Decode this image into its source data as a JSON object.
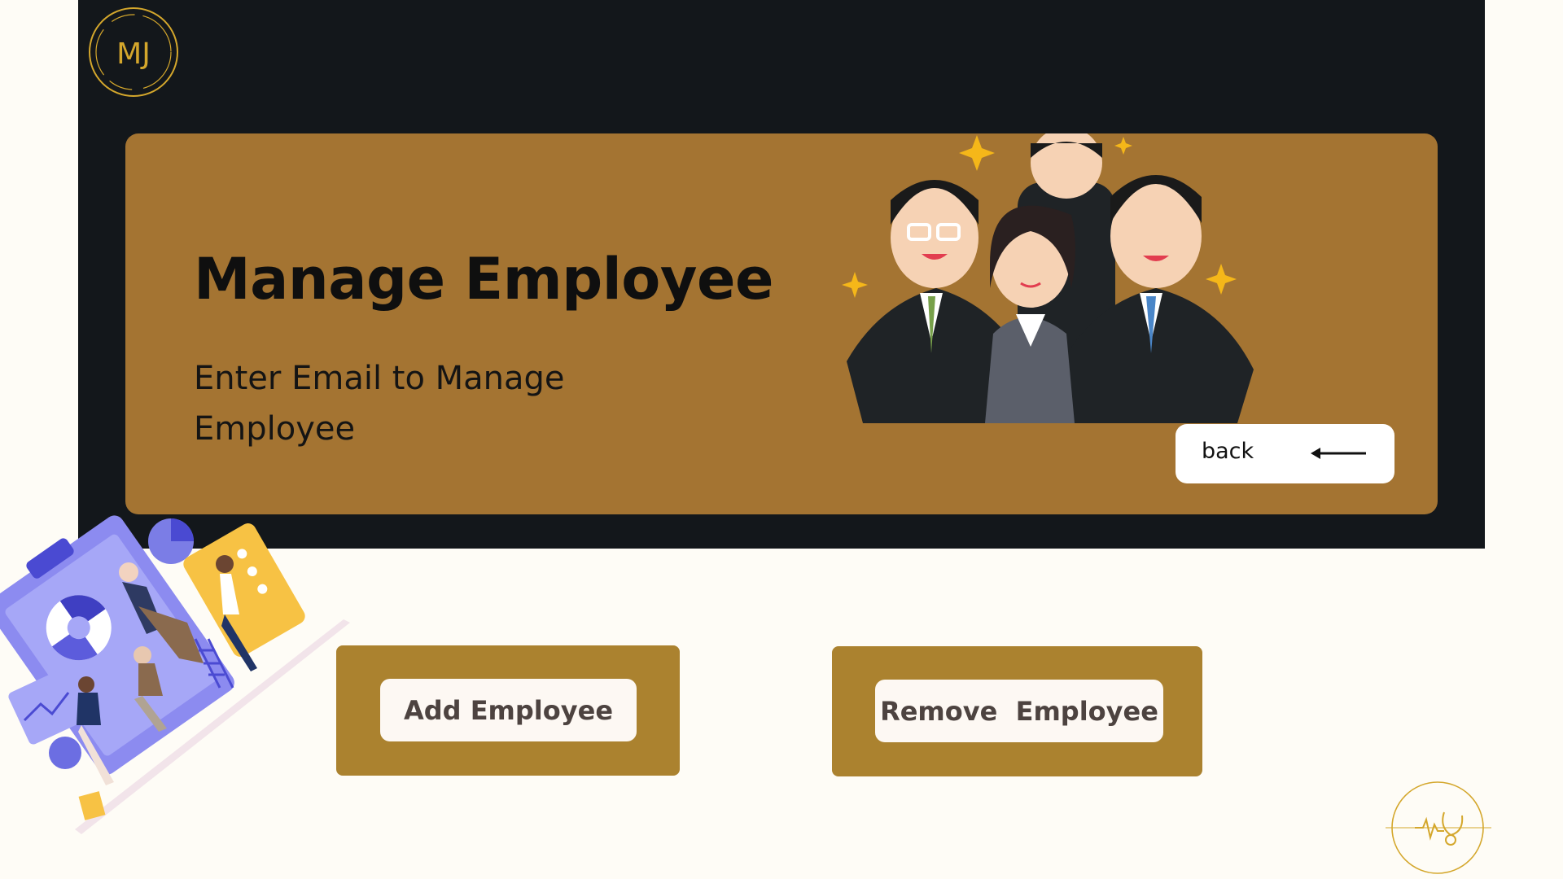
{
  "logo": {
    "text": "MJ",
    "icon": "mj-monogram-logo",
    "color": "#d4a72c"
  },
  "hero": {
    "title": "Manage Employee",
    "subtitle": "Enter Email to Manage Employee",
    "illustration": "celebrating-office-team-illustration",
    "back_button": {
      "label": "back",
      "icon": "arrow-left-icon"
    }
  },
  "actions": {
    "add_label": "Add Employee",
    "remove_label": "Remove  Employee"
  },
  "decor": {
    "left_illustration": "office-analytics-team-illustration",
    "footer_emblem": "heartbeat-stethoscope-emblem"
  },
  "colors": {
    "page_bg": "#fefcf6",
    "header_bg": "#13171b",
    "hero_bg": "#a47432",
    "card_bg": "#ab822f",
    "accent_gold": "#d4a72c"
  }
}
